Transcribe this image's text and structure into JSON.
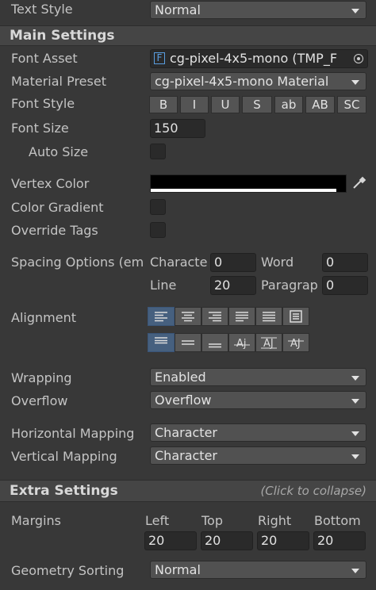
{
  "text_style": {
    "label": "Text Style",
    "value": "Normal"
  },
  "main_settings": {
    "title": "Main Settings",
    "font_asset": {
      "label": "Font Asset",
      "icon_glyph": "F",
      "value": "cg-pixel-4x5-mono (TMP_F"
    },
    "material_preset": {
      "label": "Material Preset",
      "value": "cg-pixel-4x5-mono Material"
    },
    "font_style": {
      "label": "Font Style",
      "buttons": [
        "B",
        "I",
        "U",
        "S",
        "ab",
        "AB",
        "SC"
      ]
    },
    "font_size": {
      "label": "Font Size",
      "value": "150"
    },
    "auto_size": {
      "label": "Auto Size",
      "checked": false
    },
    "vertex_color": {
      "label": "Vertex Color",
      "color": "#000000"
    },
    "color_gradient": {
      "label": "Color Gradient",
      "checked": false
    },
    "override_tags": {
      "label": "Override Tags",
      "checked": false
    },
    "spacing": {
      "label": "Spacing Options (em",
      "character_label": "Characte",
      "character_value": "0",
      "word_label": "Word",
      "word_value": "0",
      "line_label": "Line",
      "line_value": "20",
      "paragraph_label": "Paragrap",
      "paragraph_value": "0"
    },
    "alignment": {
      "label": "Alignment",
      "horizontal": [
        "align-left-icon",
        "align-center-icon",
        "align-right-icon",
        "align-justified-icon",
        "align-flush-icon",
        "align-geometry-center-icon"
      ],
      "vertical": [
        "align-top-icon",
        "align-middle-icon",
        "align-bottom-icon",
        "align-baseline-icon",
        "align-midline-icon",
        "align-capline-icon"
      ],
      "active_horizontal": 0,
      "active_vertical": 0
    },
    "wrapping": {
      "label": "Wrapping",
      "value": "Enabled"
    },
    "overflow": {
      "label": "Overflow",
      "value": "Overflow"
    },
    "horizontal_mapping": {
      "label": "Horizontal Mapping",
      "value": "Character"
    },
    "vertical_mapping": {
      "label": "Vertical Mapping",
      "value": "Character"
    }
  },
  "extra_settings": {
    "title": "Extra Settings",
    "hint": "(Click to collapse)",
    "margins": {
      "label": "Margins",
      "left_label": "Left",
      "left_value": "20",
      "top_label": "Top",
      "top_value": "20",
      "right_label": "Right",
      "right_value": "20",
      "bottom_label": "Bottom",
      "bottom_value": "20"
    },
    "geometry_sorting": {
      "label": "Geometry Sorting",
      "value": "Normal"
    }
  },
  "colors": {
    "accent": "#46607f",
    "background": "#383838"
  }
}
